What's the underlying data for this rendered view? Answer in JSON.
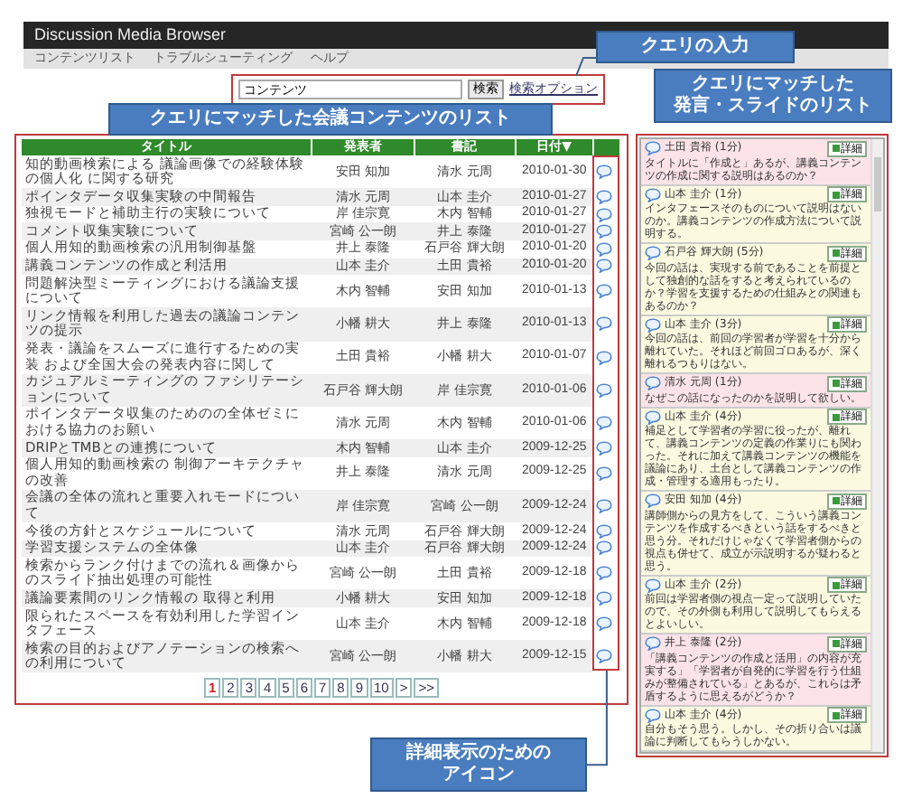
{
  "window": {
    "title": "Discussion Media Browser"
  },
  "nav": [
    "コンテンツリスト",
    "トラブルシューティング",
    "ヘルプ"
  ],
  "search": {
    "value": "コンテンツ",
    "button": "検索",
    "options_link": "検索オプション"
  },
  "table": {
    "columns": [
      "タイトル",
      "発表者",
      "書記",
      "日付▼"
    ],
    "rows": [
      {
        "title": "知的動画検索による 議論画像での経験体験の個人化 に関する研究",
        "presenter": "安田 知加",
        "recorder": "清水 元周",
        "date": "2010-01-30"
      },
      {
        "title": "ポインタデータ収集実験の中間報告",
        "presenter": "清水 元周",
        "recorder": "山本 圭介",
        "date": "2010-01-27"
      },
      {
        "title": "独視モードと補助主行の実験について",
        "presenter": "岸 佳宗寛",
        "recorder": "木内 智輔",
        "date": "2010-01-27"
      },
      {
        "title": "コメント収集実験について",
        "presenter": "宮崎 公一朗",
        "recorder": "井上 泰隆",
        "date": "2010-01-27"
      },
      {
        "title": "個人用知的動画検索の汎用制御基盤",
        "presenter": "井上 泰隆",
        "recorder": "石戸谷 輝大朗",
        "date": "2010-01-20"
      },
      {
        "title": "講義コンテンツの作成と利活用",
        "presenter": "山本 圭介",
        "recorder": "土田 貴裕",
        "date": "2010-01-20"
      },
      {
        "title": "問題解決型ミーティングにおける議論支援について",
        "presenter": "木内 智輔",
        "recorder": "安田 知加",
        "date": "2010-01-13"
      },
      {
        "title": "リンク情報を利用した過去の議論コンテンツの提示",
        "presenter": "小幡 耕大",
        "recorder": "井上 泰隆",
        "date": "2010-01-13"
      },
      {
        "title": "発表・議論をスムーズに進行するための実装 および全国大会の発表内容に関して",
        "presenter": "土田 貴裕",
        "recorder": "小幡 耕大",
        "date": "2010-01-07"
      },
      {
        "title": "カジュアルミーティングの ファシリテーションについて",
        "presenter": "石戸谷 輝大朗",
        "recorder": "岸 佳宗寛",
        "date": "2010-01-06"
      },
      {
        "title": "ポインタデータ収集のためのの全体ゼミにおける協力のお願い",
        "presenter": "清水 元周",
        "recorder": "木内 智輔",
        "date": "2010-01-06"
      },
      {
        "title": "DRIPとTMBとの連携について",
        "presenter": "木内 智輔",
        "recorder": "山本 圭介",
        "date": "2009-12-25"
      },
      {
        "title": "個人用知的動画検索の 制御アーキテクチャの改善",
        "presenter": "井上 泰隆",
        "recorder": "清水 元周",
        "date": "2009-12-25"
      },
      {
        "title": "会議の全体の流れと重要入れモードについて",
        "presenter": "岸 佳宗寛",
        "recorder": "宮崎 公一朗",
        "date": "2009-12-24"
      },
      {
        "title": "今後の方針とスケジュールについて",
        "presenter": "清水 元周",
        "recorder": "石戸谷 輝大朗",
        "date": "2009-12-24"
      },
      {
        "title": "学習支援システムの全体像",
        "presenter": "山本 圭介",
        "recorder": "石戸谷 輝大朗",
        "date": "2009-12-24"
      },
      {
        "title": "検索からランク付けまでの流れ＆画像からのスライド抽出処理の可能性",
        "presenter": "宮崎 公一朗",
        "recorder": "土田 貴裕",
        "date": "2009-12-18"
      },
      {
        "title": "議論要素間のリンク情報の 取得と利用",
        "presenter": "小幡 耕大",
        "recorder": "安田 知加",
        "date": "2009-12-18"
      },
      {
        "title": "限られたスペースを有効利用した学習インタフェース",
        "presenter": "山本 圭介",
        "recorder": "木内 智輔",
        "date": "2009-12-18"
      },
      {
        "title": "検索の目的およびアノテーションの検索への利用について",
        "presenter": "宮崎 公一朗",
        "recorder": "小幡 耕大",
        "date": "2009-12-15"
      }
    ]
  },
  "pagination": {
    "pages": [
      {
        "label": "1",
        "selected": true
      },
      {
        "label": "2",
        "selected": false
      },
      {
        "label": "3",
        "selected": false
      },
      {
        "label": "4",
        "selected": false
      },
      {
        "label": "5",
        "selected": false
      },
      {
        "label": "6",
        "selected": false
      },
      {
        "label": "7",
        "selected": false
      },
      {
        "label": "8",
        "selected": false
      },
      {
        "label": "9",
        "selected": false
      },
      {
        "label": "10",
        "selected": false
      },
      {
        "label": ">",
        "selected": false
      },
      {
        "label": ">>",
        "selected": false
      }
    ]
  },
  "posts": [
    {
      "speaker": "土田 貴裕 (1分)",
      "text": "タイトルに「作成と」あるが、講義コンテンツの作成に関する説明はあるのか？",
      "color": "#fbe3e8",
      "button": "詳細"
    },
    {
      "speaker": "山本 圭介 (1分)",
      "text": "インタフェースそのものについて説明はないのか。講義コンテンツの作成方法について説明する。",
      "color": "#fcf9e1",
      "button": "詳細"
    },
    {
      "speaker": "石戸谷 輝大朗 (5分)",
      "text": "今回の話は、実現する前であることを前提として独創的な話をすると考えられているのか？学習を支援するための仕組みとの関連もあるのか？",
      "color": "#fcf9e1",
      "button": "詳細"
    },
    {
      "speaker": "山本 圭介 (3分)",
      "text": "今回の話は、前回の学習者が学習を十分から離れていた。それほど前回ゴロあるが、深く離れるつもりはない。",
      "color": "#fcf9e1",
      "button": "詳細"
    },
    {
      "speaker": "清水 元周 (1分)",
      "text": "なぜこの話になったのかを説明して欲しい。",
      "color": "#fbe3e8",
      "button": "詳細"
    },
    {
      "speaker": "山本 圭介 (4分)",
      "text": "補足として学習者の学習に役ったが、離れて、講義コンテンツの定義の作業りにも関わった。それに加えて講義コンテンツの機能を議論にあり、土台として講義コンテンツの作成・管理する適用もったり。",
      "color": "#fcf9e1",
      "button": "詳細"
    },
    {
      "speaker": "安田 知加 (4分)",
      "text": "講師側からの見方をして、こういう講義コンテンツを作成するべきという話をするべきと思う分。それだけじゃなくて学習者側からの視点も併せて、成立が示説明するが疑わると思う。",
      "color": "#fcf9e1",
      "button": "詳細"
    },
    {
      "speaker": "山本 圭介 (2分)",
      "text": "前回は学習者側の視点一定って説明していたので、その外側も利用して説明してもらえるとよいしい。",
      "color": "#fcf9e1",
      "button": "詳細"
    },
    {
      "speaker": "井上 泰隆 (2分)",
      "text": "「講義コンテンツの作成と活用」の内容が充実する」「学習者が自発的に学習を行う仕組みが整備されている」とあるが、これらは矛盾するように思えるがどうか？",
      "color": "#fbe3e8",
      "button": "詳細"
    },
    {
      "speaker": "山本 圭介 (4分)",
      "text": "自分もそう思う。しかし、その折り合いは議論に判断してもらうしかない。",
      "color": "#fcf9e1",
      "button": "詳細"
    }
  ],
  "annotations": [
    {
      "lines": [
        "クエリの入力"
      ]
    },
    {
      "lines": [
        "クエリにマッチした",
        "発言・スライドのリスト"
      ]
    },
    {
      "lines": [
        "クエリにマッチした会議コンテンツのリスト"
      ]
    },
    {
      "lines": [
        "詳細表示のための",
        "アイコン"
      ]
    }
  ]
}
